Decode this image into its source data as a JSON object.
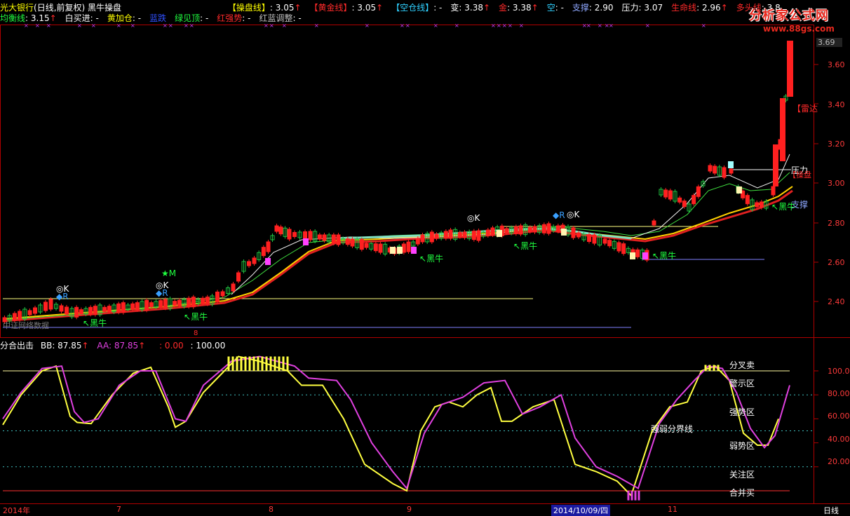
{
  "header": {
    "stock_name": "光大银行",
    "period": "(日线,前复权)",
    "indicator_name": "黑牛操盘",
    "row1": [
      {
        "label": "【操盘线】",
        "value": ": 3.05",
        "arrow": "↑",
        "label_color": "#ffff00"
      },
      {
        "label": "【黄金线】",
        "value": ": 3.05",
        "arrow": "↑",
        "label_color": "#ff2a2a"
      },
      {
        "label": "【空仓线】",
        "value": ": -",
        "arrow": "",
        "label_color": "#2fd0ff"
      },
      {
        "label": "变",
        "value": ": 3.38",
        "arrow": "↑",
        "label_color": "#ffffff"
      },
      {
        "label": "金",
        "value": ": 3.38",
        "arrow": "↑",
        "label_color": "#ff2a2a"
      },
      {
        "label": "空",
        "value": ": -",
        "arrow": "",
        "label_color": "#2fd0ff"
      },
      {
        "label": "支撑",
        "value": ": 2.90",
        "arrow": "",
        "label_color": "#8fa8ff"
      },
      {
        "label": "压力",
        "value": ": 3.07",
        "arrow": "",
        "label_color": "#ffffff"
      },
      {
        "label": "生命线",
        "value": ": 2.96",
        "arrow": "↑",
        "label_color": "#ff2a2a"
      },
      {
        "label": "多头线",
        "value": ": 3.8",
        "arrow": "",
        "label_color": "#ff2a2a"
      }
    ],
    "row2": [
      {
        "label": "均衡线",
        "value": ": 3.15",
        "arrow": "↑",
        "label_color": "#20ff40"
      },
      {
        "label": "白买进",
        "value": ": -",
        "arrow": "",
        "label_color": "#ffffff"
      },
      {
        "label": "黄加仓",
        "value": ": -",
        "arrow": "",
        "label_color": "#ffff00"
      },
      {
        "label": "蓝跌",
        "value": "",
        "arrow": "",
        "label_color": "#3050ff"
      },
      {
        "label": "绿见顶",
        "value": ": -",
        "arrow": "",
        "label_color": "#20ff40"
      },
      {
        "label": "红强势",
        "value": ": -",
        "arrow": "",
        "label_color": "#ff2a2a"
      },
      {
        "label": "红蓝调整",
        "value": ": -",
        "arrow": "",
        "label_color": "#c0c0c0"
      }
    ]
  },
  "logo": {
    "text": "分析家公式网",
    "url": "www.88gs.com"
  },
  "price_axis": {
    "current": "3.69",
    "ticks": [
      "3.60",
      "3.40",
      "3.20",
      "3.00",
      "2.80",
      "2.60",
      "2.40"
    ]
  },
  "chart_labels": {
    "leida": "【雷达",
    "yali": "压力",
    "caopan": "【操盘",
    "zhicheng": "支撑",
    "heiniu": "黑牛",
    "k_mark": "◎K",
    "r_mark": "◆R",
    "m_mark": "★M",
    "watermark": "中证网络数据",
    "small_mark": "8"
  },
  "sub_header": {
    "title": "分合出击",
    "bb_label": "BB",
    "bb_value": ": 87.85",
    "bb_arrow": "↑",
    "aa_label": "AA",
    "aa_value": ": 87.85",
    "aa_arrow": "↑",
    "c_value": ": 0.00",
    "d_value": ": 100.00"
  },
  "osc_axis": {
    "ticks": [
      "100.00",
      "80.00",
      "60.00",
      "40.00",
      "20.00"
    ]
  },
  "osc_zones": [
    "分叉卖",
    "警示区",
    "强势区",
    "强弱分界线",
    "弱势区",
    "关注区",
    "合并买"
  ],
  "dates": [
    {
      "text": "2014年"
    },
    {
      "text": "7"
    },
    {
      "text": "8"
    },
    {
      "text": "9"
    },
    {
      "text": "2014/10/09/四"
    },
    {
      "text": "11"
    }
  ],
  "period_tab": "日线",
  "colors": {
    "background": "#000000",
    "frame": "#b00000",
    "up": "#ff2a2a",
    "down": "#20ff40",
    "accent": "#ffff00",
    "osc": "#e040e0"
  }
}
